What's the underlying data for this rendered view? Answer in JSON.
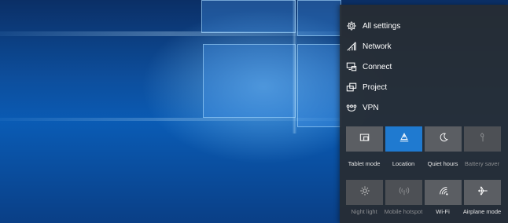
{
  "action_center": {
    "quick_links": [
      {
        "label": "All settings",
        "icon": "gear-icon"
      },
      {
        "label": "Network",
        "icon": "network-icon"
      },
      {
        "label": "Connect",
        "icon": "connect-icon"
      },
      {
        "label": "Project",
        "icon": "project-icon"
      },
      {
        "label": "VPN",
        "icon": "vpn-icon"
      }
    ],
    "tiles": [
      {
        "label": "Tablet mode",
        "icon": "tablet-mode-icon",
        "state": "off"
      },
      {
        "label": "Location",
        "icon": "location-icon",
        "state": "on"
      },
      {
        "label": "Quiet hours",
        "icon": "moon-icon",
        "state": "off"
      },
      {
        "label": "Battery saver",
        "icon": "battery-saver-icon",
        "state": "disabled"
      },
      {
        "label": "Night light",
        "icon": "brightness-icon",
        "state": "disabled"
      },
      {
        "label": "Mobile hotspot",
        "icon": "hotspot-icon",
        "state": "disabled"
      },
      {
        "label": "Wi-Fi",
        "icon": "wifi-icon",
        "state": "off"
      },
      {
        "label": "Airplane mode",
        "icon": "airplane-icon",
        "state": "off"
      }
    ]
  },
  "colors": {
    "accent": "#1f7ad0",
    "panel_bg": "#282c32",
    "tile_bg": "#5b5e63"
  }
}
